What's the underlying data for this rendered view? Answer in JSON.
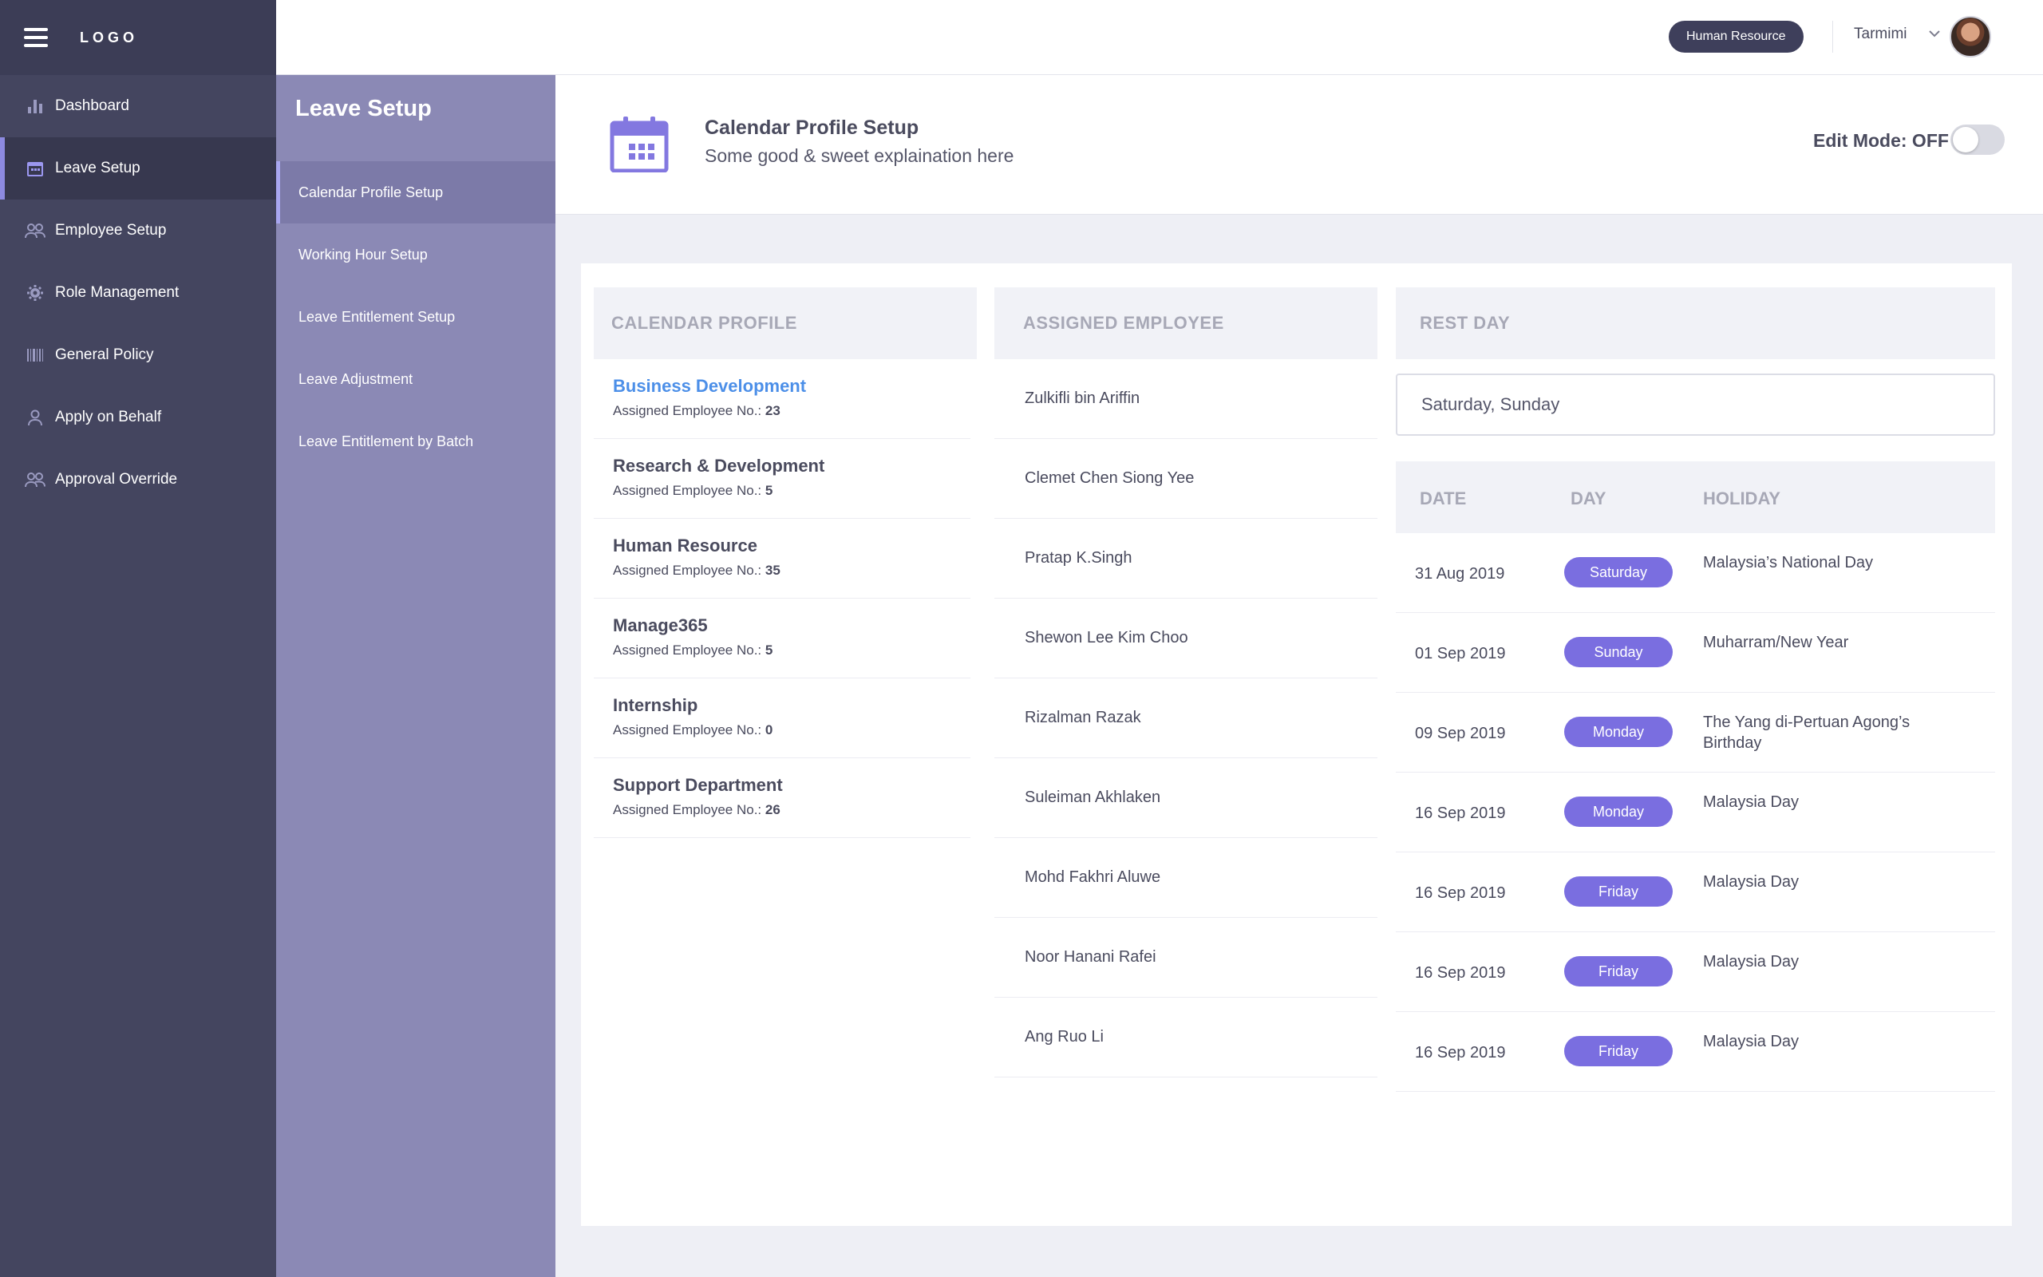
{
  "app": {
    "logo": "LOGO"
  },
  "main_nav": [
    {
      "label": "Dashboard",
      "icon": "bar-chart-icon",
      "active": false
    },
    {
      "label": "Leave Setup",
      "icon": "calendar-icon",
      "active": true
    },
    {
      "label": "Employee Setup",
      "icon": "users-icon",
      "active": false
    },
    {
      "label": "Role Management",
      "icon": "gear-icon",
      "active": false
    },
    {
      "label": "General Policy",
      "icon": "barcode-icon",
      "active": false
    },
    {
      "label": "Apply on Behalf",
      "icon": "user-icon",
      "active": false
    },
    {
      "label": "Approval Override",
      "icon": "users-icon",
      "active": false
    }
  ],
  "sub_nav": {
    "title": "Leave Setup",
    "items": [
      {
        "label": "Calendar Profile Setup",
        "active": true
      },
      {
        "label": "Working Hour Setup",
        "active": false
      },
      {
        "label": "Leave Entitlement Setup",
        "active": false
      },
      {
        "label": "Leave Adjustment",
        "active": false
      },
      {
        "label": "Leave Entitlement by Batch",
        "active": false
      }
    ]
  },
  "header": {
    "role": "Human Resource",
    "username": "Tarmimi"
  },
  "page": {
    "title": "Calendar Profile Setup",
    "subtitle": "Some good & sweet explaination here",
    "edit_mode_label": "Edit Mode: OFF",
    "edit_mode_on": false
  },
  "calendar_profile": {
    "header": "CALENDAR PROFILE",
    "count_label": "Assigned Employee No.:",
    "items": [
      {
        "name": "Business Development",
        "count": "23",
        "selected": true
      },
      {
        "name": "Research & Development",
        "count": "5",
        "selected": false
      },
      {
        "name": "Human Resource",
        "count": "35",
        "selected": false
      },
      {
        "name": "Manage365",
        "count": "5",
        "selected": false
      },
      {
        "name": "Internship",
        "count": "0",
        "selected": false
      },
      {
        "name": "Support Department",
        "count": "26",
        "selected": false
      }
    ]
  },
  "assigned_employee": {
    "header": "ASSIGNED EMPLOYEE",
    "items": [
      "Zulkifli bin Ariffin",
      "Clemet Chen Siong Yee",
      "Pratap K.Singh",
      "Shewon Lee Kim Choo",
      "Rizalman Razak",
      "Suleiman Akhlaken",
      "Mohd Fakhri Aluwe",
      "Noor Hanani Rafei",
      "Ang Ruo Li"
    ]
  },
  "rest_day": {
    "header": "REST DAY",
    "value": "Saturday, Sunday"
  },
  "holidays": {
    "columns": [
      "DATE",
      "DAY",
      "HOLIDAY"
    ],
    "rows": [
      {
        "date": "31 Aug 2019",
        "day": "Saturday",
        "holiday": "Malaysia’s National Day"
      },
      {
        "date": "01 Sep 2019",
        "day": "Sunday",
        "holiday": "Muharram/New Year"
      },
      {
        "date": "09 Sep 2019",
        "day": "Monday",
        "holiday": "The Yang di-Pertuan Agong’s Birthday"
      },
      {
        "date": "16 Sep 2019",
        "day": "Monday",
        "holiday": "Malaysia Day"
      },
      {
        "date": "16 Sep 2019",
        "day": "Friday",
        "holiday": "Malaysia Day"
      },
      {
        "date": "16 Sep 2019",
        "day": "Friday",
        "holiday": "Malaysia Day"
      },
      {
        "date": "16 Sep 2019",
        "day": "Friday",
        "holiday": "Malaysia Day"
      }
    ]
  },
  "colors": {
    "nav_bg": "#44455f",
    "subnav_bg": "#8b89b5",
    "accent": "#7a6ee0",
    "link": "#4c8fe8"
  }
}
